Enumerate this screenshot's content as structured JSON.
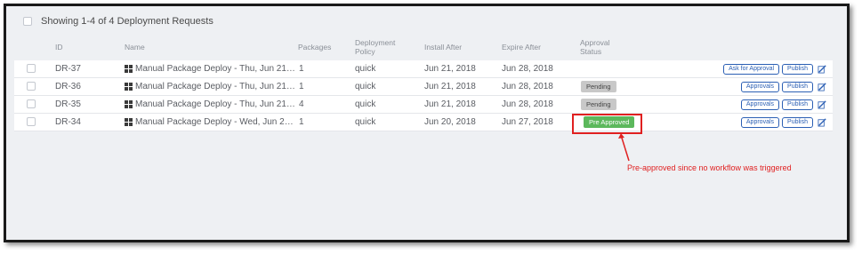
{
  "header": {
    "showing_text": "Showing 1-4 of 4 Deployment Requests"
  },
  "table": {
    "columns": {
      "id": "ID",
      "name": "Name",
      "packages": "Packages",
      "policy_line1": "Deployment",
      "policy_line2": "Policy",
      "install": "Install After",
      "expire": "Expire After",
      "approval_line1": "Approval",
      "approval_line2": "Status"
    },
    "rows": [
      {
        "id": "DR-37",
        "name": "Manual Package Deploy - Thu, Jun 21, ...",
        "packages": "1",
        "policy": "quick",
        "install": "Jun 21, 2018",
        "expire": "Jun 28, 2018",
        "status": "",
        "action1": "Ask for Approval",
        "action2": "Publish"
      },
      {
        "id": "DR-36",
        "name": "Manual Package Deploy - Thu, Jun 21, ...",
        "packages": "1",
        "policy": "quick",
        "install": "Jun 21, 2018",
        "expire": "Jun 28, 2018",
        "status": "Pending",
        "action1": "Approvals",
        "action2": "Publish"
      },
      {
        "id": "DR-35",
        "name": "Manual Package Deploy - Thu, Jun 21, ...",
        "packages": "4",
        "policy": "quick",
        "install": "Jun 21, 2018",
        "expire": "Jun 28, 2018",
        "status": "Pending",
        "action1": "Approvals",
        "action2": "Publish"
      },
      {
        "id": "DR-34",
        "name": "Manual Package Deploy - Wed, Jun 20...",
        "packages": "1",
        "policy": "quick",
        "install": "Jun 20, 2018",
        "expire": "Jun 27, 2018",
        "status": "Pre Approved",
        "action1": "Approvals",
        "action2": "Publish"
      }
    ]
  },
  "annotation": {
    "text": "Pre-approved since no workflow was triggered",
    "color": "#e02020"
  },
  "colors": {
    "link": "#2b5fb4",
    "pending": "#c8c8c8",
    "pre_approved": "#5cb85c"
  },
  "icons": {
    "os_icon": "windows-icon",
    "edit_icon": "edit-icon"
  }
}
